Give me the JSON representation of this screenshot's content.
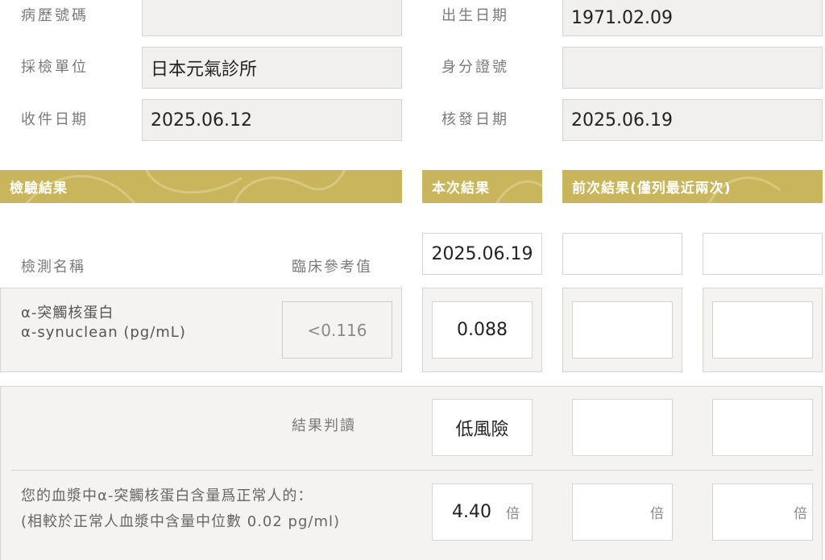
{
  "patient": {
    "record_no_label": "病歷號碼",
    "record_no_value": "",
    "birth_label": "出生日期",
    "birth_value": "1971.02.09",
    "unit_label": "採檢單位",
    "unit_value": "日本元氣診所",
    "id_label": "身分證號",
    "id_value": "",
    "received_label": "收件日期",
    "received_value": "2025.06.12",
    "issued_label": "核發日期",
    "issued_value": "2025.06.19"
  },
  "bands": {
    "results": "檢驗結果",
    "current": "本次結果",
    "previous": "前次結果(僅列最近兩次)"
  },
  "columns": {
    "test_name": "檢測名稱",
    "reference": "臨床參考值",
    "current_date": "2025.06.19",
    "prev1_date": "",
    "prev2_date": ""
  },
  "test": {
    "name_zh": "α-突觸核蛋白",
    "name_en": "α-synuclean (pg/mL)",
    "reference_value": "<0.116",
    "current_value": "0.088",
    "prev1_value": "",
    "prev2_value": ""
  },
  "interpretation": {
    "label": "結果判讀",
    "current": "低風險",
    "prev1": "",
    "prev2": ""
  },
  "ratio": {
    "line1": "您的血漿中α-突觸核蛋白含量爲正常人的：",
    "line2": "(相較於正常人血漿中含量中位數 0.02 pg/ml)",
    "current_value": "4.40",
    "unit": "倍",
    "prev1_value": "",
    "prev2_value": ""
  },
  "colors": {
    "band": "#c9b55c",
    "panel": "#f4f3f1",
    "field": "#f1f0ef",
    "border": "#d6d4d1"
  }
}
